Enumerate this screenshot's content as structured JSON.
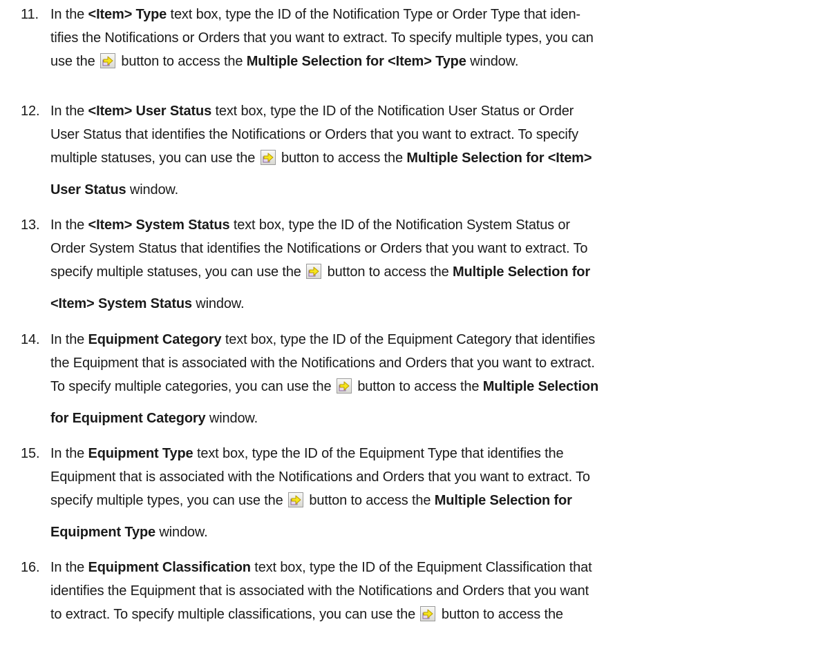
{
  "steps": [
    {
      "number": "11.",
      "lines": [
        [
          "In the ",
          {
            "b": "<Item> Type"
          },
          " text box, type the ID of the Notification Type or Order Type that iden-"
        ],
        [
          "tifies the Notifications or Orders that you want to extract. To specify multiple types, you can"
        ],
        [
          "use the ",
          {
            "btn": "multiple-selection-arrow-icon"
          },
          " button to access the ",
          {
            "b": "Multiple Selection for <Item> Type"
          },
          " window."
        ]
      ]
    },
    {
      "number": "12.",
      "lines": [
        [
          "In the ",
          {
            "b": "<Item> User Status"
          },
          " text box, type the ID of the Notification User Status or Order"
        ],
        [
          "User Status that identifies the Notifications or Orders that you want to extract. To specify"
        ],
        [
          "multiple statuses, you can use the ",
          {
            "btn": "multiple-selection-arrow-icon"
          },
          " button to access the ",
          {
            "b": "Multiple Selection for <Item>"
          }
        ],
        [
          {
            "b": "User Status"
          },
          " window."
        ]
      ]
    },
    {
      "number": "13.",
      "lines": [
        [
          "In the ",
          {
            "b": "<Item> System Status"
          },
          " text box, type the ID of the Notification System Status or"
        ],
        [
          "Order System Status that identifies the Notifications or Orders that you want to extract. To"
        ],
        [
          "specify multiple statuses, you can use the ",
          {
            "btn": "multiple-selection-arrow-icon"
          },
          " button to access the ",
          {
            "b": "Multiple Selection for"
          }
        ],
        [
          {
            "b": "<Item> System Status"
          },
          " window."
        ]
      ]
    },
    {
      "number": "14.",
      "lines": [
        [
          "In the ",
          {
            "b": "Equipment Category"
          },
          " text box, type the ID of the Equipment Category that identifies"
        ],
        [
          "the Equipment that is associated with the Notifications and Orders that you want to extract."
        ],
        [
          "To specify multiple categories, you can use the ",
          {
            "btn": "multiple-selection-arrow-icon"
          },
          " button to access the ",
          {
            "b": "Multiple Selection"
          }
        ],
        [
          {
            "b": "for Equipment Category"
          },
          " window."
        ]
      ]
    },
    {
      "number": "15.",
      "lines": [
        [
          "In the ",
          {
            "b": "Equipment Type"
          },
          " text box, type the ID of the Equipment Type that identifies the"
        ],
        [
          "Equipment  that is associated with the Notifications and Orders that you want to extract. To"
        ],
        [
          "specify multiple types, you can use the ",
          {
            "btn": "multiple-selection-arrow-icon"
          },
          " button to access the ",
          {
            "b": "Multiple Selection for"
          }
        ],
        [
          {
            "b": "Equipment Type"
          },
          " window."
        ]
      ]
    },
    {
      "number": "16.",
      "lines": [
        [
          "In the ",
          {
            "b": "Equipment Classification"
          },
          " text box, type the ID of the Equipment Classification that"
        ],
        [
          "identifies the Equipment that is associated with the Notifications and Orders that you want"
        ],
        [
          "to extract. To specify multiple classifications, you can use the ",
          {
            "btn": "multiple-selection-arrow-icon"
          },
          " button to access the"
        ]
      ]
    }
  ],
  "colors": {
    "text": "#1a1a1a",
    "button_arrow_fill": "#f5e51c",
    "button_arrow_stroke": "#b89a00",
    "button_box_fill": "#e7d6ef"
  }
}
